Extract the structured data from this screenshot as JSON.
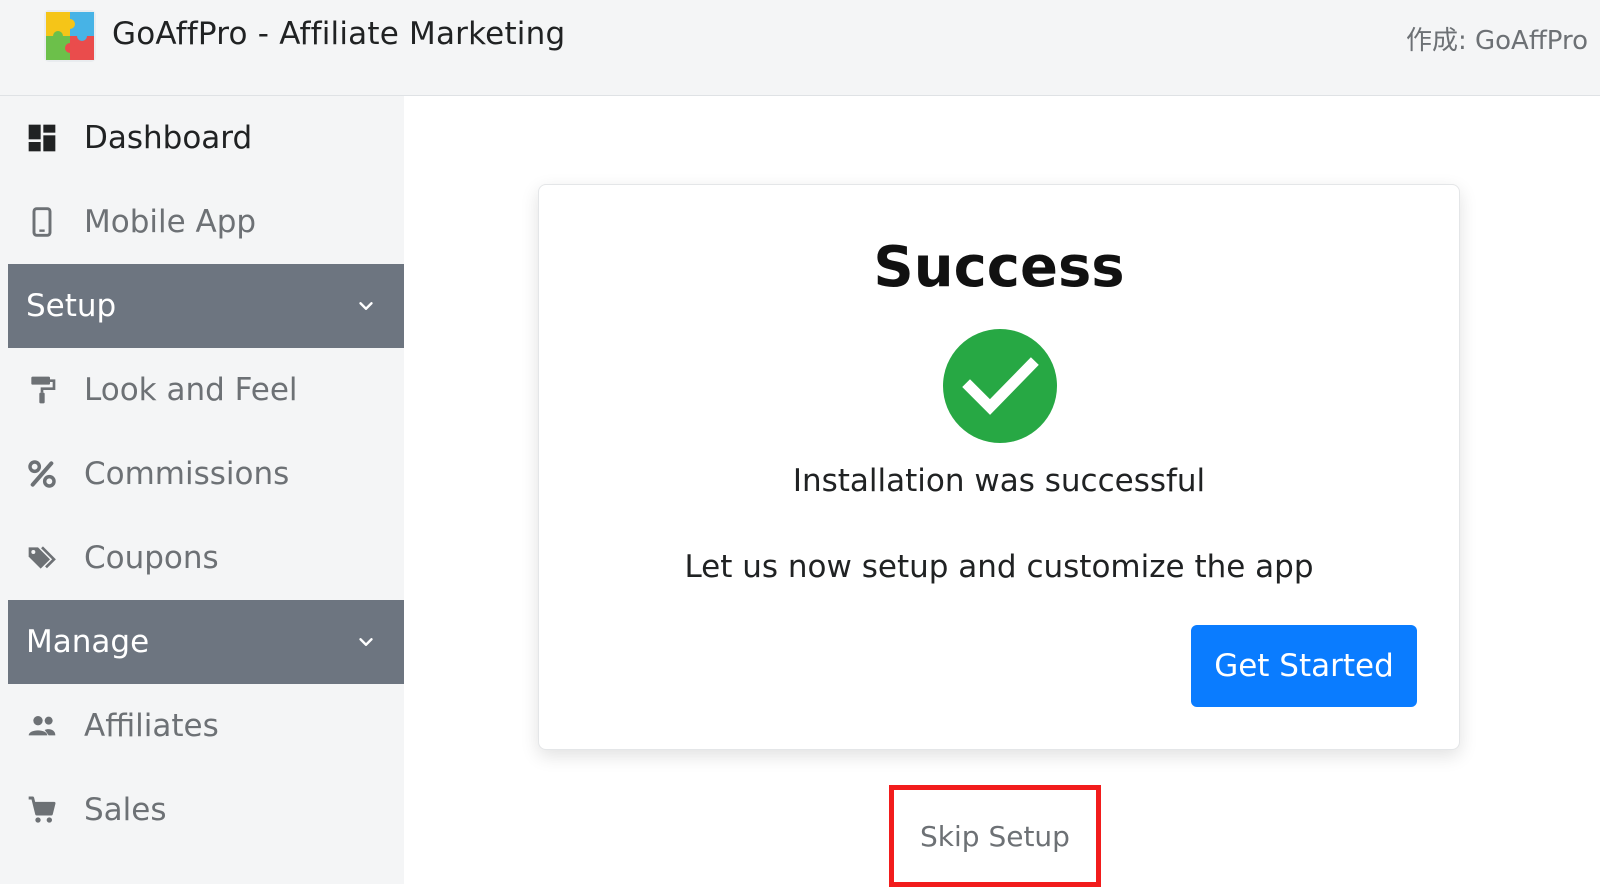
{
  "header": {
    "app_title": "GoAffPro - Affiliate Marketing",
    "author": "作成: GoAffPro",
    "logo_icon": "puzzle-logo-icon"
  },
  "sidebar": {
    "items": [
      {
        "label": "Dashboard",
        "icon": "dashboard-icon"
      },
      {
        "label": "Mobile App",
        "icon": "mobile-icon"
      },
      {
        "label": "Look and Feel",
        "icon": "paint-roller-icon"
      },
      {
        "label": "Commissions",
        "icon": "percent-icon"
      },
      {
        "label": "Coupons",
        "icon": "tags-icon"
      },
      {
        "label": "Affiliates",
        "icon": "users-icon"
      },
      {
        "label": "Sales",
        "icon": "cart-icon"
      }
    ],
    "sections": [
      {
        "label": "Setup"
      },
      {
        "label": "Manage"
      }
    ]
  },
  "card": {
    "title": "Success",
    "success_message": "Installation was successful",
    "setup_message": "Let us now setup and customize the app",
    "button_label": "Get Started"
  },
  "skip_link": "Skip Setup",
  "colors": {
    "accent": "#0a7cff",
    "success": "#27a844",
    "section_bg": "#6d7580",
    "highlight": "#f21c1c"
  }
}
